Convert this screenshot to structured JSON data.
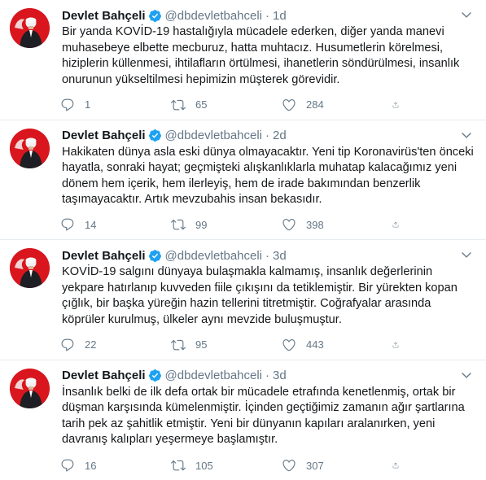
{
  "tweets": [
    {
      "name": "Devlet Bahçeli",
      "handle": "@dbdevletbahceli",
      "separator": "·",
      "time": "1d",
      "text": "Bir yanda KOVİD-19 hastalığıyla mücadele ederken, diğer yanda manevi muhasebeye elbette mecburuz, hatta muhtacız. Husumetlerin körelmesi, hiziplerin küllenmesi, ihtilafların örtülmesi, ihanetlerin söndürülmesi, insanlık onurunun yükseltilmesi hepimizin müşterek görevidir.",
      "replies": "1",
      "retweets": "65",
      "likes": "284"
    },
    {
      "name": "Devlet Bahçeli",
      "handle": "@dbdevletbahceli",
      "separator": "·",
      "time": "2d",
      "text": "Hakikaten dünya asla eski dünya olmayacaktır. Yeni tip Koronavirüs'ten önceki hayatla, sonraki hayat; geçmişteki alışkanlıklarla muhatap kalacağımız yeni dönem hem içerik, hem ilerleyiş, hem de irade bakımından benzerlik taşımayacaktır. Artık mevzubahis insan bekasıdır.",
      "replies": "14",
      "retweets": "99",
      "likes": "398"
    },
    {
      "name": "Devlet Bahçeli",
      "handle": "@dbdevletbahceli",
      "separator": "·",
      "time": "3d",
      "text": "KOVİD-19 salgını dünyaya bulaşmakla kalmamış, insanlık değerlerinin yekpare hatırlanıp kuvveden fiile çıkışını da tetiklemiştir. Bir yürekten kopan çığlık, bir başka yüreğin hazin tellerini titretmiştir. Coğrafyalar arasında köprüler kurulmuş, ülkeler aynı mevzide buluşmuştur.",
      "replies": "22",
      "retweets": "95",
      "likes": "443"
    },
    {
      "name": "Devlet Bahçeli",
      "handle": "@dbdevletbahceli",
      "separator": "·",
      "time": "3d",
      "text": "İnsanlık belki de ilk defa ortak bir mücadele etrafında kenetlenmiş, ortak bir düşman karşısında kümelenmiştir. İçinden geçtiğimiz zamanın ağır şartlarına tarih pek az şahitlik etmiştir. Yeni bir dünyanın kapıları aralanırken, yeni davranış kalıpları yeşermeye başlamıştır.",
      "replies": "16",
      "retweets": "105",
      "likes": "307"
    }
  ],
  "icons": {
    "avatar": "profile-photo",
    "verified": "verified-badge-icon",
    "caret": "chevron-down-icon",
    "reply": "reply-icon",
    "retweet": "retweet-icon",
    "like": "heart-icon",
    "share": "share-icon"
  },
  "colors": {
    "text": "#14171a",
    "secondary": "#657786",
    "verified": "#1da1f2",
    "divider": "#e6ecf0",
    "avatar_background": "#d9161d"
  }
}
